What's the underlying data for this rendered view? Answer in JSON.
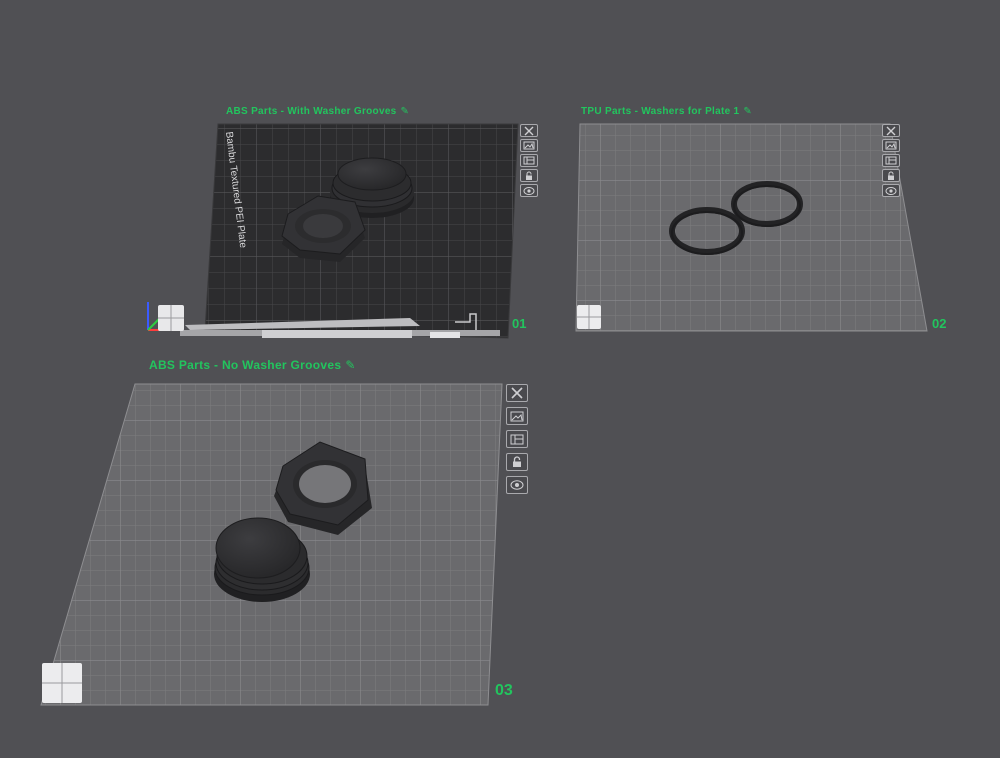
{
  "plates": [
    {
      "title": "ABS Parts - With Washer Grooves",
      "number": "01",
      "plate_label": "Bambu Textured PEI Plate",
      "tools": [
        "close-icon",
        "image-icon",
        "arrange-icon",
        "lock-icon",
        "settings-icon"
      ]
    },
    {
      "title": "TPU Parts - Washers for Plate 1",
      "number": "02",
      "tools": [
        "close-icon",
        "image-icon",
        "arrange-icon",
        "lock-icon",
        "settings-icon"
      ]
    },
    {
      "title": "ABS Parts - No Washer Grooves",
      "number": "03",
      "tools": [
        "close-icon",
        "image-icon",
        "arrange-icon",
        "lock-icon",
        "settings-icon"
      ]
    }
  ],
  "edit_icon": "✎",
  "colors": {
    "background": "#505054",
    "accent": "#22c55e",
    "dark_plate": "#2c2c2e",
    "light_plate": "#6a6a6d",
    "part": "#2f2f31"
  }
}
